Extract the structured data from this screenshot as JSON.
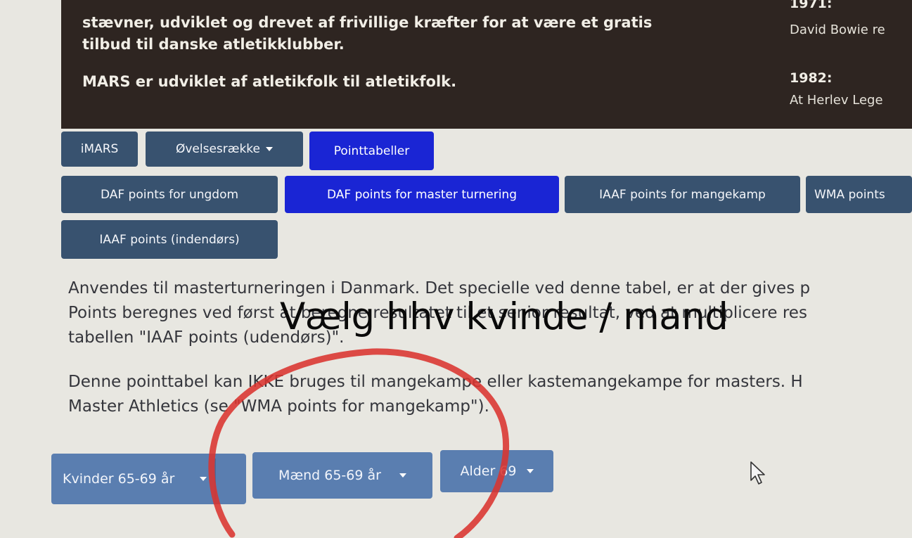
{
  "header": {
    "intro_lines": [
      "stævner, udviklet og drevet af frivillige kræfter for at være et gratis",
      "tilbud til danske atletikklubber."
    ],
    "mars_name": "MARS",
    "mars_tail": " er udviklet af atletikfolk til atletikfolk.",
    "side": [
      {
        "year": "1971:",
        "text": "David Bowie re"
      },
      {
        "year": "1982:",
        "text": "At Herlev Lege"
      }
    ]
  },
  "nav": {
    "items": [
      {
        "label": "iMARS",
        "dropdown": false,
        "active": false
      },
      {
        "label": "Øvelsesrække",
        "dropdown": true,
        "active": false
      },
      {
        "label": "Pointtabeller",
        "dropdown": false,
        "active": true
      }
    ]
  },
  "tables": {
    "items": [
      {
        "label": "DAF points for ungdom",
        "active": false
      },
      {
        "label": "DAF points for master turnering",
        "active": true
      },
      {
        "label": "IAAF points for mangekamp",
        "active": false
      },
      {
        "label": "WMA points",
        "active": false
      },
      {
        "label": "IAAF points (indendørs)",
        "active": false
      }
    ]
  },
  "description": {
    "lines": [
      "Anvendes til masterturneringen i Danmark. Det specielle ved denne tabel, er at der gives p",
      "Points beregnes ved først at beregne resultatet til et senior resultat, ved at multiplicere res",
      "tabellen \"IAAF points (udendørs)\"."
    ],
    "note_lines": [
      "Denne pointtabel kan IKKE bruges til mangekampe eller kastemangekampe for masters. H",
      "Master Athletics (se \"WMA points for mangekamp\")."
    ]
  },
  "selectors": {
    "women": "Kvinder 65-69 år",
    "men": "Mænd 65-69 år",
    "age": "Alder 69"
  },
  "annotation": {
    "text": "Vælg hhv kvinde / mand",
    "circle_color": "#d9342f"
  },
  "colors": {
    "header_bg": "#2e2521",
    "button_bg": "#38526f",
    "button_active": "#1a25d4",
    "selector_bg": "#5a7eb0"
  }
}
